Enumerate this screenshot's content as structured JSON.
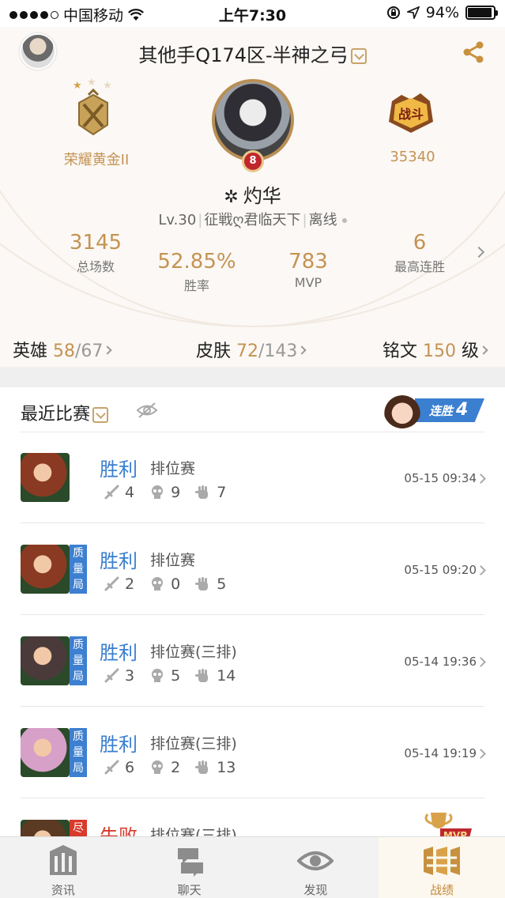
{
  "status_bar": {
    "carrier": "中国移动",
    "time": "上午7:30",
    "battery": "94%",
    "battery_level": 0.94
  },
  "profile": {
    "server": "其他手Q174区-半神之弓",
    "rank": "荣耀黄金II",
    "rank_stars": 3,
    "war_power": "35340",
    "level_badge": "8",
    "nickname": "灼华",
    "nick_symbol": "✲",
    "level": "Lv.30",
    "title": "征戦ღ君临天下",
    "status": "离线",
    "stats": {
      "total": {
        "value": "3145",
        "label": "总场数"
      },
      "winrate": {
        "value": "52.85%",
        "label": "胜率"
      },
      "mvp": {
        "value": "783",
        "label": "MVP"
      },
      "streak": {
        "value": "6",
        "label": "最高连胜"
      }
    },
    "collection": {
      "heroes": {
        "label": "英雄",
        "owned": "58",
        "total": "/67"
      },
      "skins": {
        "label": "皮肤",
        "owned": "72",
        "total": "/143"
      },
      "runes": {
        "label": "铭文",
        "level": "150",
        "unit": "级"
      }
    }
  },
  "recent": {
    "title": "最近比赛",
    "streak_label": "连胜",
    "streak_count": "4",
    "matches": [
      {
        "result": "胜利",
        "mode": "排位赛",
        "kills": "4",
        "deaths": "9",
        "assists": "7",
        "date": "05-15 09:34",
        "quality": "",
        "hero_color": "#8a3a22"
      },
      {
        "result": "胜利",
        "mode": "排位赛",
        "kills": "2",
        "deaths": "0",
        "assists": "5",
        "date": "05-15 09:20",
        "quality": "质量局",
        "hero_color": "#8a3a22"
      },
      {
        "result": "胜利",
        "mode": "排位赛(三排)",
        "kills": "3",
        "deaths": "5",
        "assists": "14",
        "date": "05-14 19:36",
        "quality": "质量局",
        "hero_color": "#4a3b3a"
      },
      {
        "result": "胜利",
        "mode": "排位赛(三排)",
        "kills": "6",
        "deaths": "2",
        "assists": "13",
        "date": "05-14 19:19",
        "quality": "质量局",
        "hero_color": "#d6a0c8"
      },
      {
        "result": "失败",
        "mode": "排位赛(三排)",
        "kills": "",
        "deaths": "",
        "assists": "",
        "date": "",
        "quality": "尽",
        "hero_color": "#5a3a22"
      }
    ],
    "mvp_badge": "MVP"
  },
  "tabs": [
    {
      "label": "资讯",
      "icon": "news-icon"
    },
    {
      "label": "聊天",
      "icon": "chat-icon"
    },
    {
      "label": "发现",
      "icon": "discover-icon"
    },
    {
      "label": "战绩",
      "icon": "record-icon",
      "active": true
    }
  ],
  "colors": {
    "gold": "#c49352",
    "win": "#3a7fd0",
    "lose": "#d83a2b",
    "quality": "#3d7fd0"
  }
}
